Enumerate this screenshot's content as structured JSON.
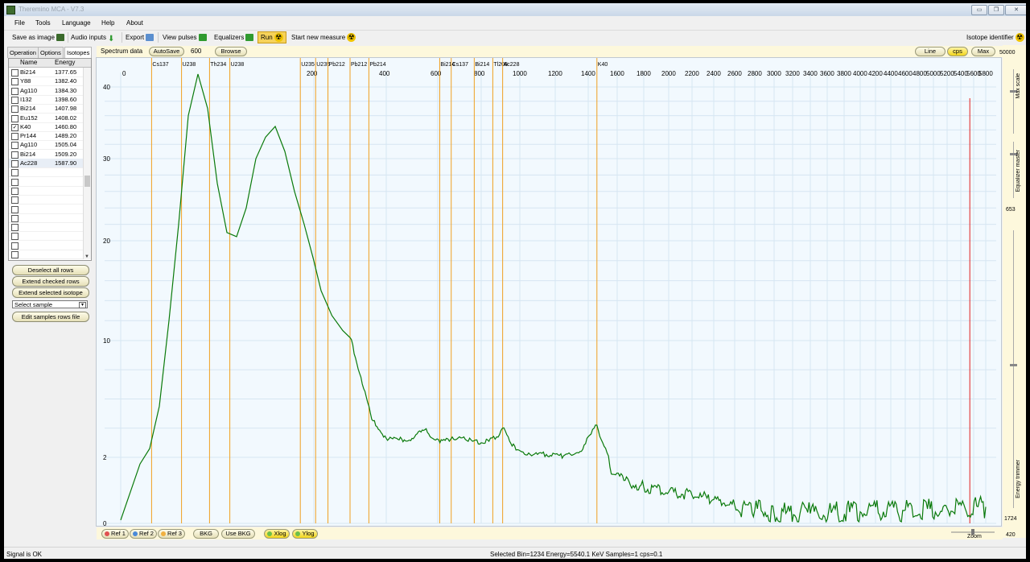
{
  "window": {
    "title": "Theremino MCA - V7.3",
    "minimize": "▭",
    "restore": "❐",
    "close": "✕"
  },
  "menu": [
    "File",
    "Tools",
    "Language",
    "Help",
    "About"
  ],
  "toolbar": {
    "save_image": "Save as image",
    "audio_inputs": "Audio inputs",
    "export": "Export",
    "view_pulses": "View pulses",
    "equalizers": "Equalizers",
    "run": "Run",
    "new_measure": "Start new measure",
    "isotope_identifier": "Isotope identifier"
  },
  "tabs": [
    "Operation",
    "Options",
    "Isotopes"
  ],
  "active_tab": "Isotopes",
  "isotope_table": {
    "headers": [
      "Name",
      "Energy"
    ],
    "rows": [
      {
        "name": "Bi214",
        "energy": "1377.65",
        "checked": false
      },
      {
        "name": "Y88",
        "energy": "1382.40",
        "checked": false
      },
      {
        "name": "Ag110",
        "energy": "1384.30",
        "checked": false
      },
      {
        "name": "I132",
        "energy": "1398.60",
        "checked": false
      },
      {
        "name": "Bi214",
        "energy": "1407.98",
        "checked": false
      },
      {
        "name": "Eu152",
        "energy": "1408.02",
        "checked": false
      },
      {
        "name": "K40",
        "energy": "1460.80",
        "checked": true
      },
      {
        "name": "Pr144",
        "energy": "1489.20",
        "checked": false
      },
      {
        "name": "Ag110",
        "energy": "1505.04",
        "checked": false
      },
      {
        "name": "Bi214",
        "energy": "1509.20",
        "checked": false
      },
      {
        "name": "Ac228",
        "energy": "1587.90",
        "checked": false
      },
      {
        "name": "",
        "energy": "",
        "checked": false
      },
      {
        "name": "",
        "energy": "",
        "checked": false
      },
      {
        "name": "",
        "energy": "",
        "checked": false
      },
      {
        "name": "",
        "energy": "",
        "checked": false
      },
      {
        "name": "",
        "energy": "",
        "checked": false
      },
      {
        "name": "",
        "energy": "",
        "checked": false
      },
      {
        "name": "",
        "energy": "",
        "checked": false
      },
      {
        "name": "",
        "energy": "",
        "checked": false
      },
      {
        "name": "",
        "energy": "",
        "checked": false
      },
      {
        "name": "",
        "energy": "",
        "checked": false
      }
    ]
  },
  "panel_buttons": {
    "deselect_all": "Deselect all rows",
    "extend_checked": "Extend checked rows",
    "extend_selected": "Extend selected isotope",
    "select_sample": "Select sample",
    "edit_samples": "Edit samples rows file"
  },
  "spectrum_bar": {
    "label": "Spectrum data",
    "autosave": "AutoSave",
    "autosave_value": "600",
    "browse": "Browse",
    "line": "Line",
    "cps": "cps",
    "max": "Max"
  },
  "right_panel": {
    "top_value": "50000",
    "max_scale": "Max scale",
    "equalizer_master": "Equalizer master",
    "mid_value": "653",
    "energy_trimmer": "Energy trimmer",
    "bottom_value": "1724",
    "zoom_value": "420",
    "zoom_label": "Zoom"
  },
  "bottom_buttons": {
    "ref1": "Ref 1",
    "ref2": "Ref 2",
    "ref3": "Ref 3",
    "bkg": "BKG",
    "use_bkg": "Use BKG",
    "xlog": "Xlog",
    "ylog": "Ylog"
  },
  "status": {
    "signal": "Signal is OK",
    "info": "Selected Bin=1234  Energy=5540.1 KeV  Samples=1  cps=0.1"
  },
  "colors": {
    "spectrum": "#0a7a0a",
    "isotope_line": "#f0a020",
    "cursor": "#e02020",
    "plot_bg": "#f2f9fe",
    "grid": "#d6e6f2"
  },
  "chart_data": {
    "type": "line",
    "xlabel": "",
    "ylabel": "",
    "x_scale": "log",
    "y_scale": "log",
    "x_ticks": [
      0,
      200,
      400,
      600,
      800,
      1000,
      1200,
      1400,
      1600,
      1800,
      2000,
      2200,
      2400,
      2600,
      2800,
      3000,
      3200,
      3400,
      3600,
      3800,
      4000,
      4200,
      4400,
      4600,
      4800,
      5000,
      5200,
      5400,
      5600,
      5800
    ],
    "y_ticks": [
      0,
      2,
      10,
      20,
      30,
      40
    ],
    "isotope_markers": [
      {
        "label": "Cs137",
        "energy": 32
      },
      {
        "label": "U238",
        "energy": 63
      },
      {
        "label": "Th234",
        "energy": 92
      },
      {
        "label": "U238",
        "energy": 113
      },
      {
        "label": "U235",
        "energy": 186
      },
      {
        "label": "U235",
        "energy": 205
      },
      {
        "label": "Pb212",
        "energy": 239
      },
      {
        "label": "Pb212",
        "energy": 300
      },
      {
        "label": "Pb214",
        "energy": 352
      },
      {
        "label": "Bi214",
        "energy": 609
      },
      {
        "label": "Cs137",
        "energy": 662
      },
      {
        "label": "Bi214",
        "energy": 768
      },
      {
        "label": "Tl208",
        "energy": 860
      },
      {
        "label": "Ac228",
        "energy": 911
      },
      {
        "label": "K40",
        "energy": 1460
      }
    ],
    "cursor_energy": 5540.1,
    "series": [
      {
        "x": [
          0,
          20,
          30,
          40,
          50,
          60,
          70,
          80,
          90,
          100,
          110,
          120,
          130,
          140,
          150,
          160,
          170,
          180,
          190,
          200,
          220,
          250,
          280,
          300,
          330,
          360,
          400,
          450,
          500,
          550,
          580,
          610,
          640,
          680,
          720,
          760,
          800,
          840,
          880,
          910,
          940,
          980,
          1050,
          1100,
          1150,
          1250,
          1350,
          1420,
          1460,
          1500,
          1550,
          1650,
          1800,
          2000,
          2200,
          2400,
          2600,
          2800,
          3000,
          3400,
          4000,
          4600,
          5200,
          5800
        ],
        "y": [
          0.1,
          1.8,
          2.6,
          5.5,
          12,
          22,
          36,
          42,
          37,
          27,
          21,
          20.5,
          24,
          30,
          33,
          34.5,
          31,
          26,
          22,
          18,
          15,
          12.5,
          11,
          10.3,
          7.5,
          4.6,
          3.3,
          3.2,
          3.3,
          3.9,
          3.3,
          3.0,
          3.3,
          3.2,
          3.4,
          3.1,
          3.0,
          3.1,
          3.4,
          4.0,
          3.4,
          2.5,
          2.3,
          2.2,
          2.2,
          2.1,
          2.4,
          3.6,
          4.2,
          3.0,
          1.7,
          1.3,
          1.1,
          0.95,
          0.85,
          0.72,
          0.55,
          0.4,
          0.3,
          0.3,
          0.35,
          0.4,
          0.45,
          0.5
        ]
      }
    ]
  }
}
